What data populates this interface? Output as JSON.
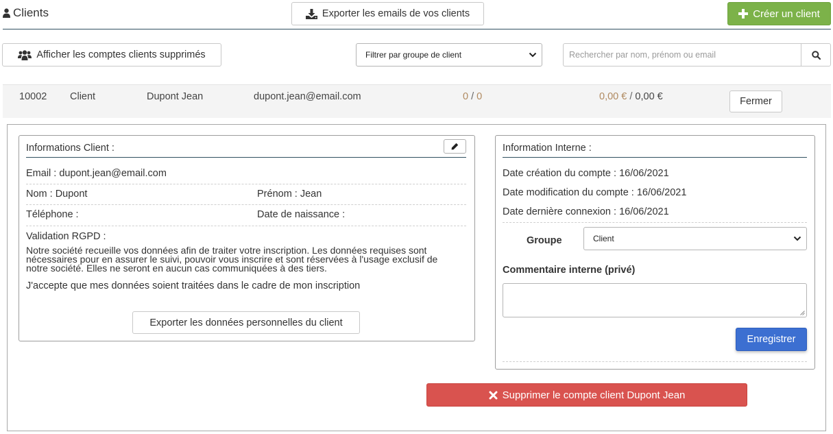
{
  "header": {
    "title": "Clients",
    "export_emails_label": "Exporter les emails de vos clients",
    "create_client_label": "Créer un client"
  },
  "toolbar": {
    "show_deleted_label": "Afficher les comptes clients supprimés",
    "group_filter_selected": "Filtrer par groupe de client",
    "search_placeholder": "Rechercher par nom, prénom ou email"
  },
  "client_row": {
    "id": "10002",
    "type": "Client",
    "name": "Dupont Jean",
    "email": "dupont.jean@email.com",
    "orders_a": "0",
    "orders_sep": " / ",
    "orders_b": "0",
    "amount_a": "0,00 €",
    "amount_sep": " / ",
    "amount_b": "0,00 €",
    "close_label": "Fermer"
  },
  "client_info": {
    "title": "Informations Client :",
    "email_line": "Email : dupont.jean@email.com",
    "nom_line": "Nom : Dupont",
    "prenom_line": "Prénom : Jean",
    "telephone_line": "Téléphone :",
    "naissance_line": "Date de naissance :",
    "rgpd_title": "Validation RGPD :",
    "rgpd_text": "Notre société recueille vos données afin de traiter votre inscription. Les données requises sont nécessaires pour en assurer le suivi, pouvoir vous inscrire et sont réservées à l'usage exclusif de notre société. Elles ne seront en aucun cas communiquées à des tiers.",
    "rgpd_accept": "J'accepte que mes données soient traitées dans le cadre de mon inscription",
    "export_data_label": "Exporter les données personnelles du client"
  },
  "internal_info": {
    "title": "Information Interne :",
    "created_line": "Date création du compte : 16/06/2021",
    "modified_line": "Date modification du compte : 16/06/2021",
    "last_login_line": "Date dernière connexion : 16/06/2021",
    "group_label": "Groupe",
    "group_selected": "Client",
    "comment_label": "Commentaire interne (privé)",
    "comment_value": "",
    "save_label": "Enregistrer"
  },
  "delete_label": "Supprimer le compte client Dupont Jean",
  "colors": {
    "create_green": "#7cb249",
    "save_blue": "#3c6fd1",
    "delete_red": "#d9534f",
    "amount_tan": "#b08a60"
  },
  "icons": {
    "title": "user-icon",
    "export": "download-icon",
    "create": "plus-icon",
    "deleted": "users-icon",
    "search": "search-icon",
    "edit": "pencil-icon",
    "delete": "times-icon"
  }
}
